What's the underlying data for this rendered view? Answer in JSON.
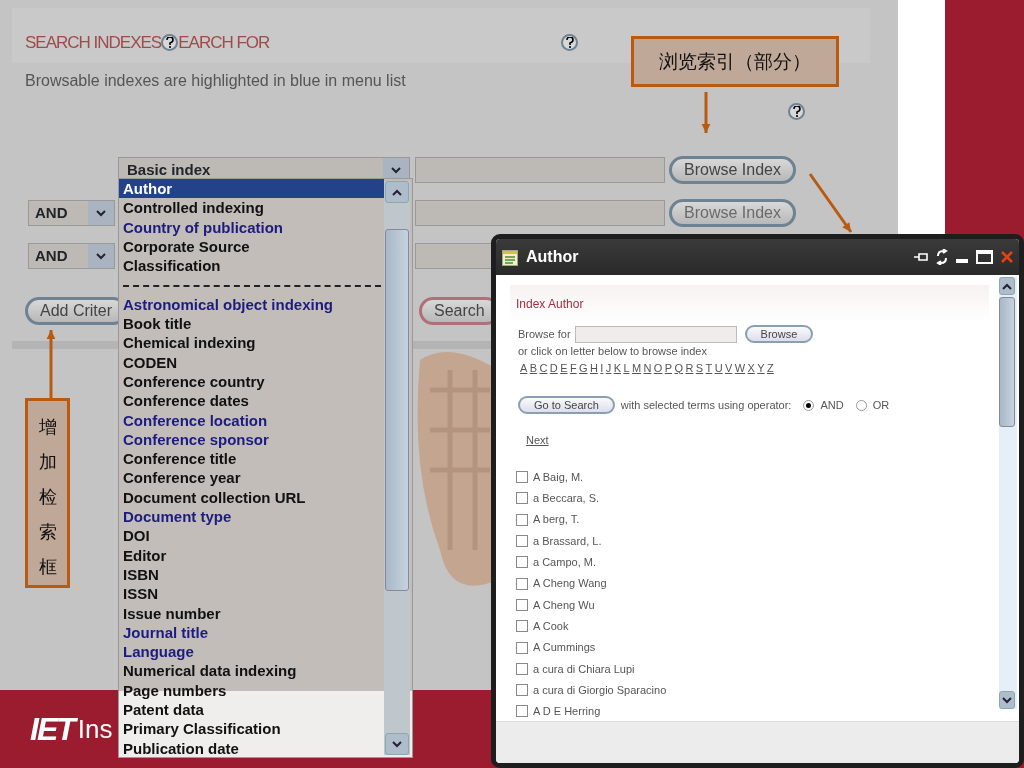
{
  "page": {
    "heading_left": "SEARCH INDEXES",
    "heading_right": "EARCH FOR",
    "note": "Browsable indexes are highlighted in blue in menu list",
    "rows": [
      {
        "index": "Basic index",
        "browse": "Browse Index",
        "disabled": false,
        "help": true
      },
      {
        "operator": "AND",
        "browse": "Browse Index",
        "disabled": true
      },
      {
        "operator": "AND"
      }
    ],
    "add_button": "Add Criter",
    "search_button": "Search",
    "footer_logo": "IET",
    "footer_text": "Ins"
  },
  "index_menu": {
    "items": [
      {
        "label": "Author",
        "browsable": true,
        "selected": true
      },
      {
        "label": "Controlled indexing",
        "browsable": false,
        "selected": false
      },
      {
        "label": "Country of publication",
        "browsable": true,
        "selected": false
      },
      {
        "label": "Corporate Source",
        "browsable": false,
        "selected": false
      },
      {
        "label": "Classification",
        "browsable": false,
        "selected": false
      },
      {
        "kind": "separator"
      },
      {
        "label": "Astronomical object indexing",
        "browsable": true,
        "selected": false
      },
      {
        "label": "Book title",
        "browsable": false,
        "selected": false
      },
      {
        "label": "Chemical indexing",
        "browsable": false,
        "selected": false
      },
      {
        "label": "CODEN",
        "browsable": false,
        "selected": false
      },
      {
        "label": "Conference country",
        "browsable": false,
        "selected": false
      },
      {
        "label": "Conference dates",
        "browsable": false,
        "selected": false
      },
      {
        "label": "Conference location",
        "browsable": true,
        "selected": false
      },
      {
        "label": "Conference sponsor",
        "browsable": true,
        "selected": false
      },
      {
        "label": "Conference title",
        "browsable": false,
        "selected": false
      },
      {
        "label": "Conference year",
        "browsable": false,
        "selected": false
      },
      {
        "label": "Document collection URL",
        "browsable": false,
        "selected": false
      },
      {
        "label": "Document type",
        "browsable": true,
        "selected": false
      },
      {
        "label": "DOI",
        "browsable": false,
        "selected": false
      },
      {
        "label": "Editor",
        "browsable": false,
        "selected": false
      },
      {
        "label": "ISBN",
        "browsable": false,
        "selected": false
      },
      {
        "label": "ISSN",
        "browsable": false,
        "selected": false
      },
      {
        "label": "Issue number",
        "browsable": false,
        "selected": false
      },
      {
        "label": "Journal title",
        "browsable": true,
        "selected": false
      },
      {
        "label": "Language",
        "browsable": true,
        "selected": false
      },
      {
        "label": "Numerical data indexing",
        "browsable": false,
        "selected": false
      },
      {
        "label": "Page numbers",
        "browsable": false,
        "selected": false
      },
      {
        "label": "Patent data",
        "browsable": false,
        "selected": false
      },
      {
        "label": "Primary Classification",
        "browsable": false,
        "selected": false
      },
      {
        "label": "Publication date",
        "browsable": false,
        "selected": false
      }
    ]
  },
  "author_window": {
    "title": "Author",
    "section_title": "Index Author",
    "browse_label": "Browse for",
    "browse_button": "Browse",
    "hint": "or click on letter below to browse index",
    "letters": [
      "A",
      "B",
      "C",
      "D",
      "E",
      "F",
      "G",
      "H",
      "I",
      "J",
      "K",
      "L",
      "M",
      "N",
      "O",
      "P",
      "Q",
      "R",
      "S",
      "T",
      "U",
      "V",
      "W",
      "X",
      "Y",
      "Z"
    ],
    "go_button": "Go to Search",
    "operator_label": "with selected terms using operator:",
    "operators": [
      {
        "label": "AND",
        "selected": true
      },
      {
        "label": "OR",
        "selected": false
      }
    ],
    "next": "Next",
    "terms": [
      {
        "label": "A Baig, M.",
        "checked": false
      },
      {
        "label": "a Beccara, S.",
        "checked": false
      },
      {
        "label": "A berg, T.",
        "checked": false
      },
      {
        "label": "a Brassard, L.",
        "checked": false
      },
      {
        "label": "a Campo, M.",
        "checked": false
      },
      {
        "label": "A Cheng Wang",
        "checked": false
      },
      {
        "label": "A Cheng Wu",
        "checked": false
      },
      {
        "label": "A Cook",
        "checked": false
      },
      {
        "label": "A Cummings",
        "checked": false
      },
      {
        "label": "a cura di Chiara Lupi",
        "checked": false
      },
      {
        "label": "a cura di Giorgio Sparacino",
        "checked": false
      },
      {
        "label": "A D E Herring",
        "checked": false
      }
    ]
  },
  "callouts": [
    {
      "kind": "horizontal",
      "text": "浏览索引（部分）"
    },
    {
      "kind": "vertical",
      "text": "增加检索框"
    }
  ]
}
